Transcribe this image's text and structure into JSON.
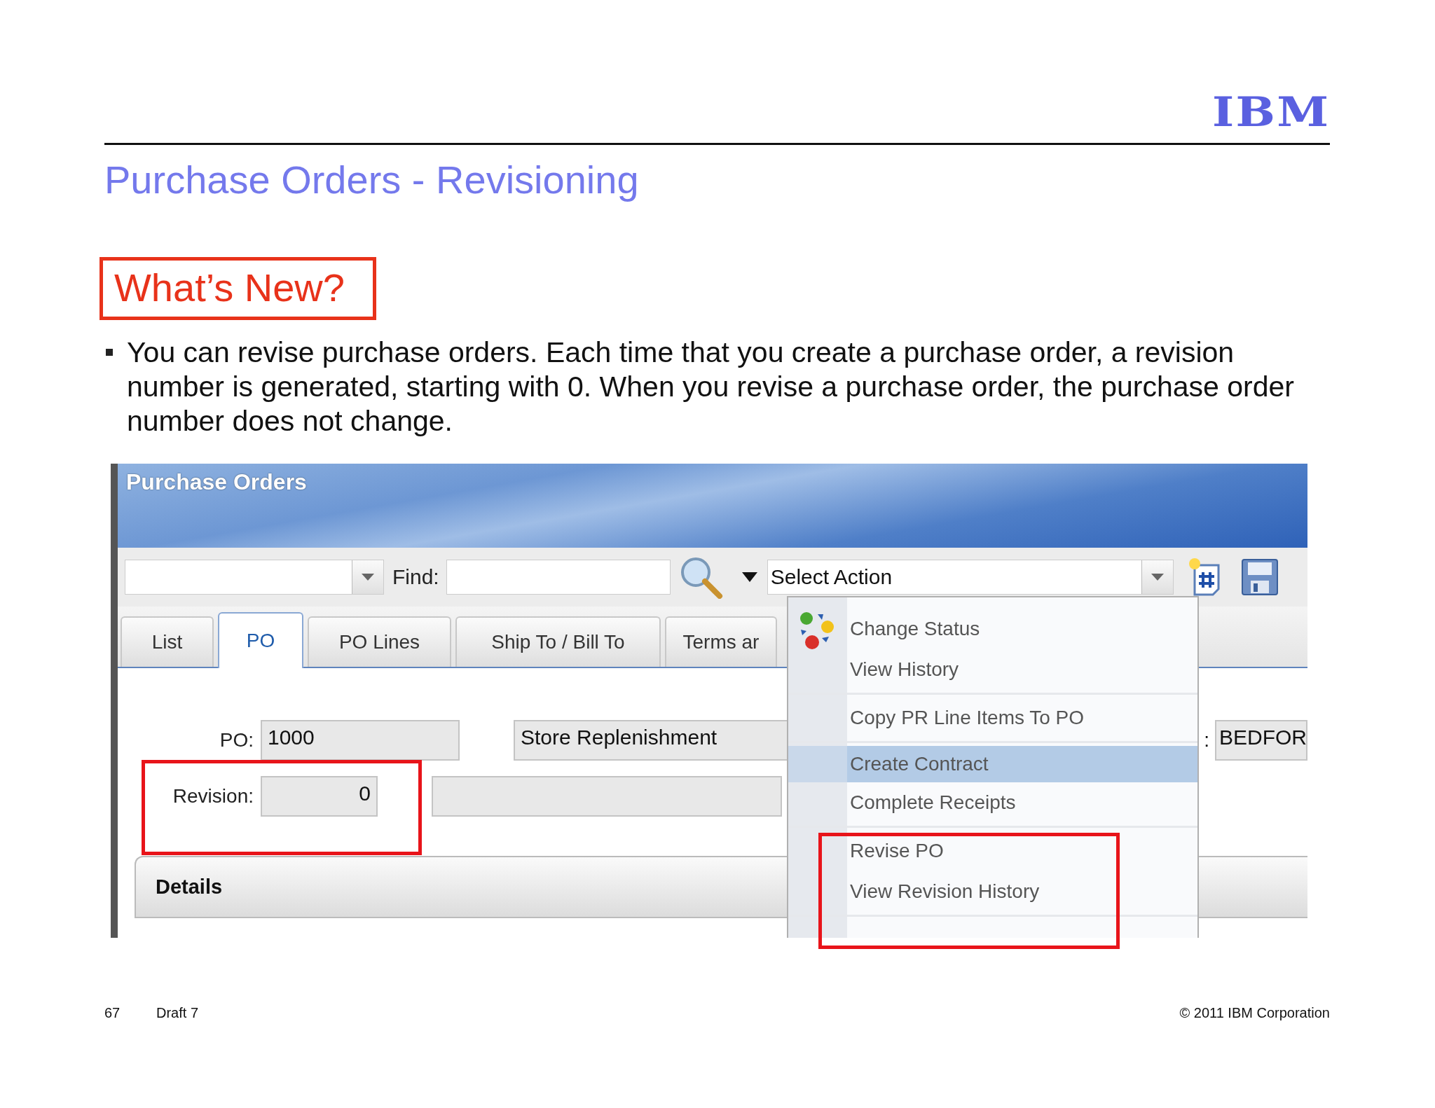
{
  "logo": "IBM",
  "title": "Purchase Orders - Revisioning",
  "callout": "What’s New?",
  "bullets": [
    "You can revise purchase orders. Each time that you create a purchase order, a revision number is generated, starting with 0. When you revise a purchase order, the purchase order number does not change."
  ],
  "app": {
    "title": "Purchase Orders",
    "toolbar": {
      "find_label": "Find:",
      "action_select": "Select Action"
    },
    "tabs": [
      {
        "label": "List",
        "selected": false
      },
      {
        "label": "PO",
        "selected": true
      },
      {
        "label": "PO Lines",
        "selected": false
      },
      {
        "label": "Ship To / Bill To",
        "selected": false
      },
      {
        "label": "Terms ar",
        "selected": false
      }
    ],
    "fields": {
      "po_label": "PO:",
      "po_value": "1000",
      "description": "Store Replenishment",
      "revision_label": "Revision:",
      "revision_value": "0",
      "right_label": ":",
      "right_value": "BEDFOR"
    },
    "section": "Details",
    "action_menu": [
      [
        {
          "label": "Change Status",
          "selected": false
        },
        {
          "label": "View History",
          "selected": false
        }
      ],
      [
        {
          "label": "Copy PR Line Items To PO",
          "selected": false
        }
      ],
      [
        {
          "label": "Create Contract",
          "selected": true
        },
        {
          "label": "Complete Receipts",
          "selected": false
        }
      ],
      [
        {
          "label": "Revise PO",
          "selected": false
        },
        {
          "label": "View Revision History",
          "selected": false
        }
      ]
    ]
  },
  "footer": {
    "page": "67",
    "draft": "Draft 7",
    "copyright": "© 2011 IBM Corporation"
  }
}
